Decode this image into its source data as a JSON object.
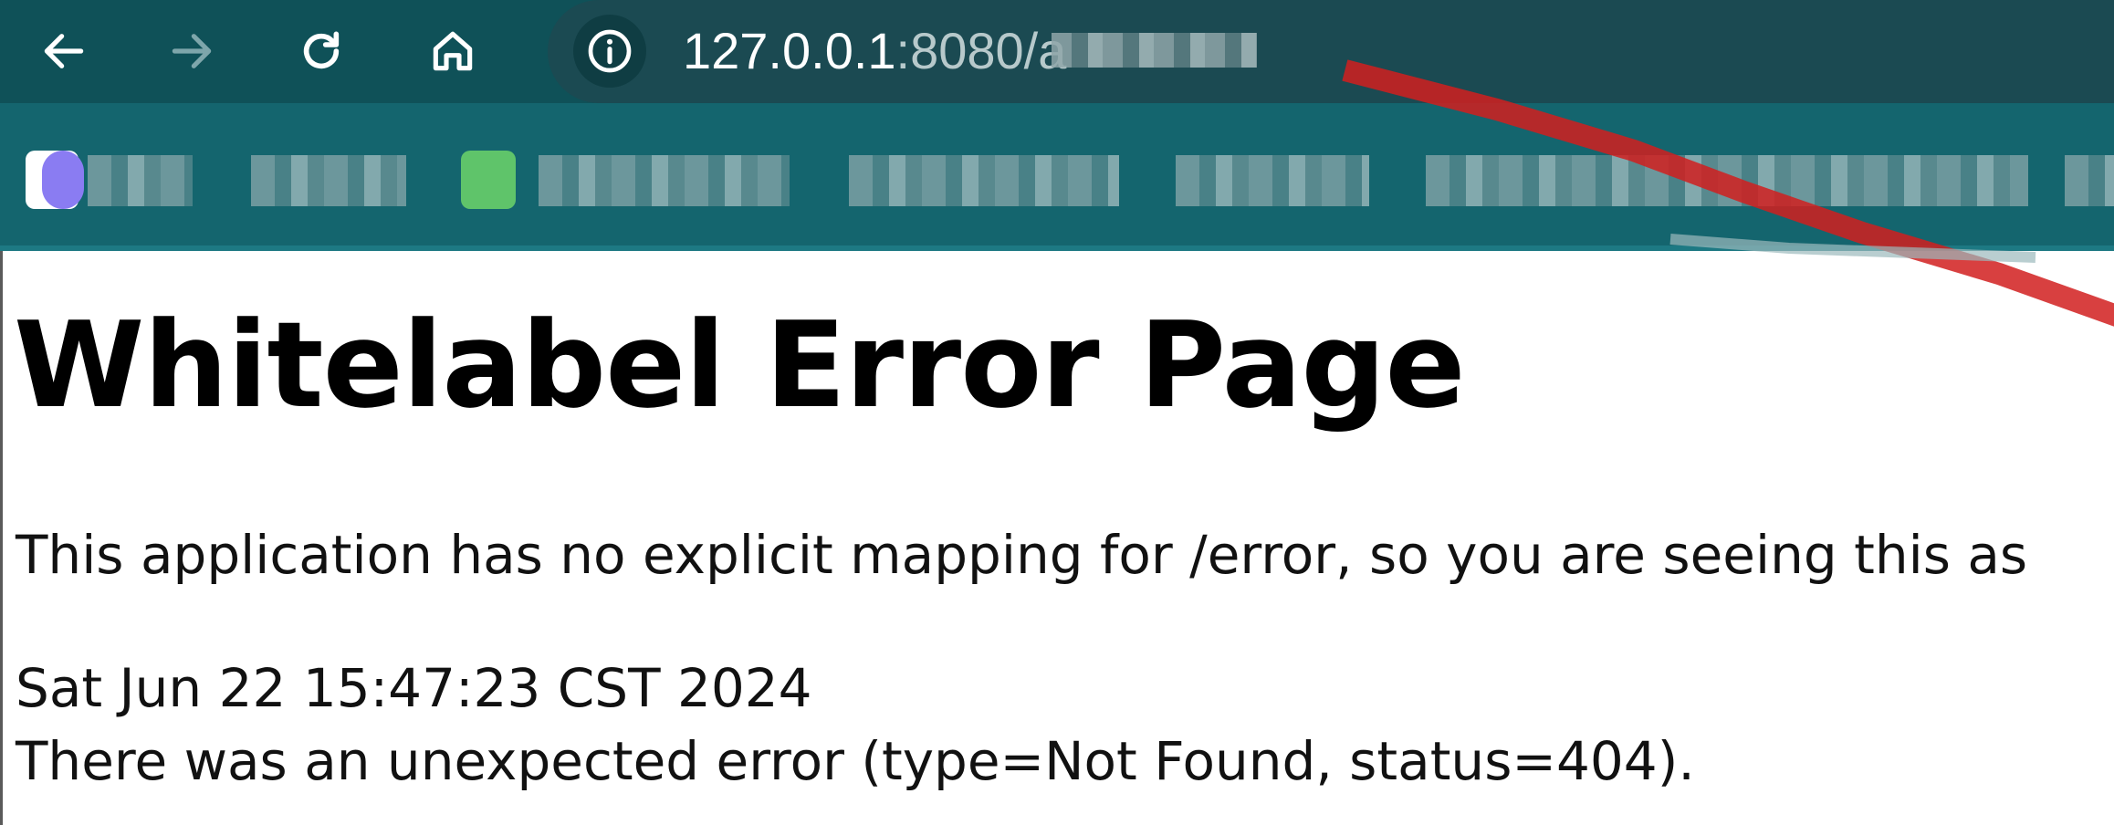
{
  "browser": {
    "nav": {
      "back_icon": "arrow-left-icon",
      "forward_icon": "arrow-right-icon",
      "reload_icon": "reload-icon",
      "home_icon": "home-icon"
    },
    "address_bar": {
      "site_info_icon": "info-icon",
      "url_host": "127.0.0.1",
      "url_port_path": ":8080/a"
    },
    "colors": {
      "toolbar": "#0f5158",
      "bookmarks_bar": "#14656e",
      "annotation_arrow": "#d11f1f"
    }
  },
  "page": {
    "title": "Whitelabel Error Page",
    "message": "This application has no explicit mapping for /error, so you are seeing this as",
    "timestamp": "Sat Jun 22 15:47:23 CST 2024",
    "error_detail": "There was an unexpected error (type=Not Found, status=404)."
  }
}
